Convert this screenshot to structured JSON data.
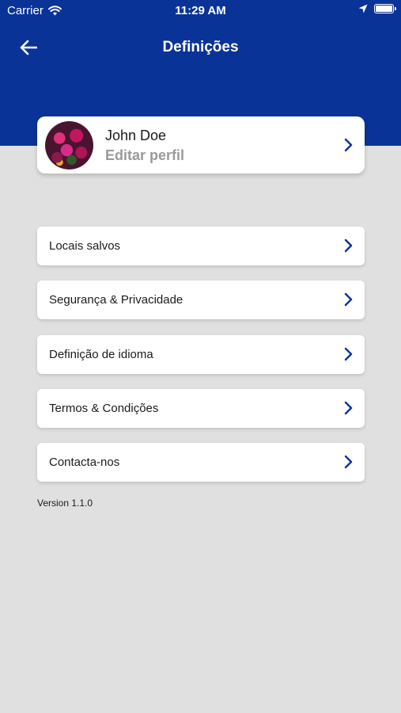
{
  "status_bar": {
    "carrier": "Carrier",
    "time": "11:29 AM"
  },
  "nav": {
    "title": "Definições"
  },
  "profile": {
    "name": "John Doe",
    "subtitle": "Editar perfil"
  },
  "menu": {
    "items": [
      {
        "label": "Locais salvos"
      },
      {
        "label": "Segurança & Privacidade"
      },
      {
        "label": "Definição de idioma"
      },
      {
        "label": "Termos & Condições"
      },
      {
        "label": "Contacta-nos"
      }
    ]
  },
  "footer": {
    "version": "Version 1.1.0"
  },
  "colors": {
    "header": "#0a3398",
    "background": "#e0e0e0",
    "chevron": "#0a3398"
  }
}
